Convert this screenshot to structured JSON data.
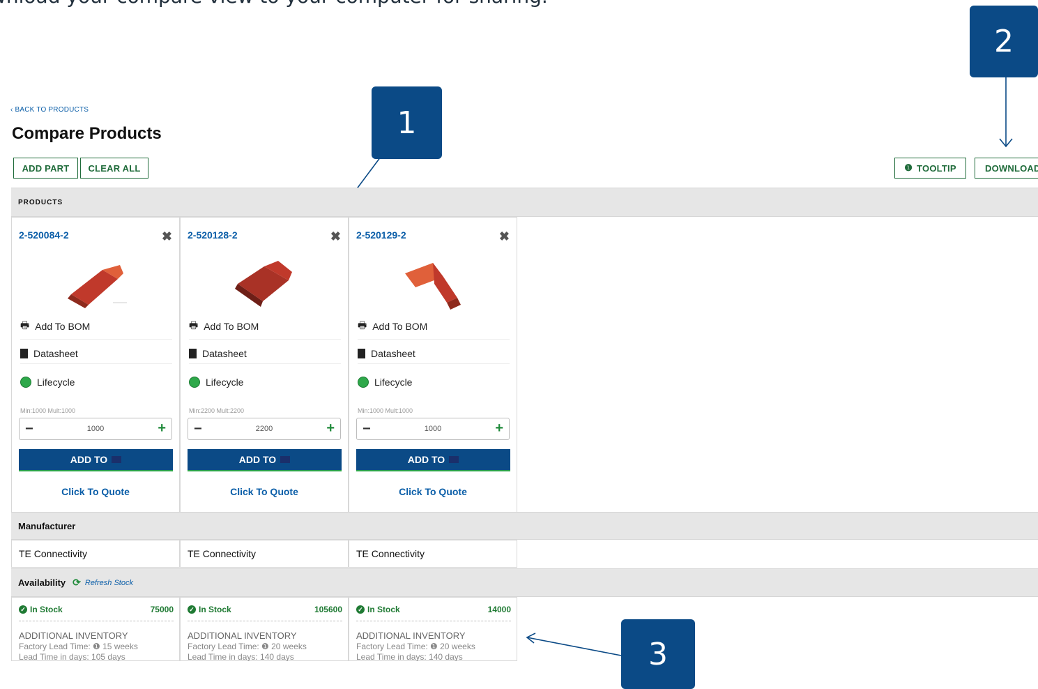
{
  "caption": "wnload your compare view to your computer for sharing.",
  "callouts": [
    "1",
    "2",
    "3"
  ],
  "colors": {
    "brand_blue": "#0b4a86",
    "green": "#1f7a33",
    "link_blue": "#0b5ea8"
  },
  "header": {
    "back_link": "‹ BACK TO PRODUCTS",
    "title": "Compare Products",
    "add_part": "ADD PART",
    "clear_all": "CLEAR ALL",
    "tooltip": "TOOLTIP",
    "download": "DOWNLOAD"
  },
  "sections": {
    "products": "PRODUCTS",
    "manufacturer": "Manufacturer",
    "availability": "Availability",
    "refresh_stock": "Refresh Stock"
  },
  "products": [
    {
      "part_number": "2-520084-2",
      "close": "✖",
      "add_bom": "Add To BOM",
      "datasheet": "Datasheet",
      "lifecycle": "Lifecycle",
      "min_mult": "Min:1000  Mult:1000",
      "qty": "1000",
      "add_to": "ADD TO",
      "quote": "Click To Quote",
      "manufacturer": "TE Connectivity",
      "stock_label": "In Stock",
      "stock_count": "75000",
      "additional": "ADDITIONAL INVENTORY",
      "factory_lead": "Factory Lead Time:  ❶  15 weeks",
      "lead_days": "Lead Time in days:  105 days"
    },
    {
      "part_number": "2-520128-2",
      "close": "✖",
      "add_bom": "Add To BOM",
      "datasheet": "Datasheet",
      "lifecycle": "Lifecycle",
      "min_mult": "Min:2200  Mult:2200",
      "qty": "2200",
      "add_to": "ADD TO",
      "quote": "Click To Quote",
      "manufacturer": "TE Connectivity",
      "stock_label": "In Stock",
      "stock_count": "105600",
      "additional": "ADDITIONAL INVENTORY",
      "factory_lead": "Factory Lead Time:  ❶  20 weeks",
      "lead_days": "Lead Time in days:  140 days"
    },
    {
      "part_number": "2-520129-2",
      "close": "✖",
      "add_bom": "Add To BOM",
      "datasheet": "Datasheet",
      "lifecycle": "Lifecycle",
      "min_mult": "Min:1000  Mult:1000",
      "qty": "1000",
      "add_to": "ADD TO",
      "quote": "Click To Quote",
      "manufacturer": "TE Connectivity",
      "stock_label": "In Stock",
      "stock_count": "14000",
      "additional": "ADDITIONAL INVENTORY",
      "factory_lead": "Factory Lead Time:  ❶  20 weeks",
      "lead_days": "Lead Time in days:  140 days"
    }
  ]
}
